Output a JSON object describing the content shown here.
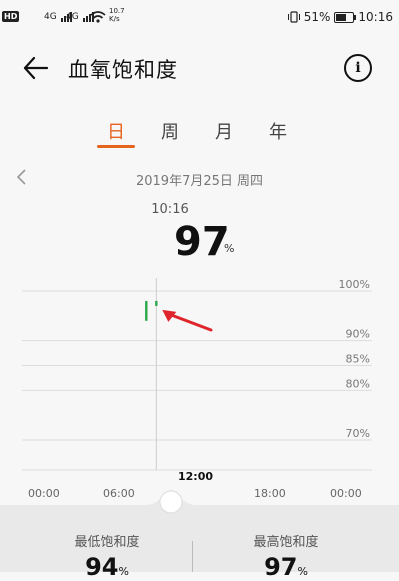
{
  "status_bar": {
    "hd": "HD",
    "sim1": "4G",
    "sim2": "4G",
    "speed_value": "10.7",
    "speed_unit": "K/s",
    "battery": "51%",
    "time": "10:16"
  },
  "header": {
    "title": "血氧饱和度",
    "back_icon": "arrow-left-icon",
    "info_icon": "info-icon"
  },
  "tabs": [
    {
      "label": "日",
      "active": true
    },
    {
      "label": "周",
      "active": false
    },
    {
      "label": "月",
      "active": false
    },
    {
      "label": "年",
      "active": false
    }
  ],
  "date_nav": {
    "date": "2019年7月25日 周四"
  },
  "reading": {
    "time": "10:16",
    "value": "97",
    "unit": "%"
  },
  "chart_data": {
    "type": "bar",
    "y_labels": [
      "100%",
      "90%",
      "85%",
      "80%",
      "70%"
    ],
    "x_labels": [
      "00:00",
      "06:00",
      "12:00",
      "18:00",
      "00:00"
    ],
    "x_ticks": [
      "00:00",
      "06:00",
      "18:00",
      "00:00"
    ],
    "x_selected": "12:00",
    "series": [
      {
        "values": [
          {
            "time": "09:30",
            "min": 94,
            "max": 98
          },
          {
            "time": "10:16",
            "min": 97,
            "max": 98
          }
        ]
      }
    ],
    "accent_color": "#2aa84a",
    "annotation_color": "#e0242b"
  },
  "stats": {
    "min_label": "最低饱和度",
    "min_value": "94",
    "max_label": "最高饱和度",
    "max_value": "97",
    "unit": "%"
  }
}
